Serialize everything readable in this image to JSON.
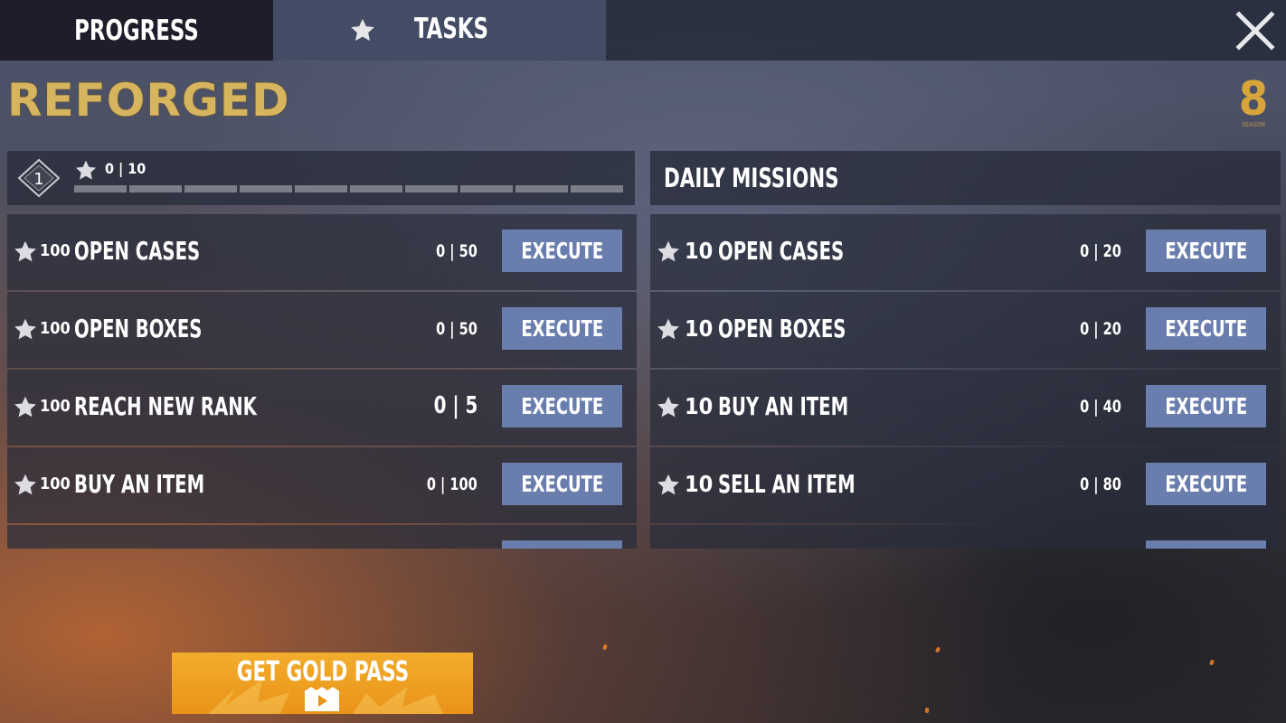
{
  "tabs": {
    "progress_label": "PROGRESS",
    "tasks_label": "TASKS"
  },
  "brand": {
    "logo_text": "REFORGED",
    "season_number": "8",
    "season_label": "SEASON"
  },
  "progress": {
    "level": "1",
    "stars": "0 | 10",
    "segments": 10,
    "filled_segments": 0
  },
  "daily": {
    "title": "DAILY MISSIONS"
  },
  "left_tasks": [
    {
      "reward": "100",
      "name": "OPEN CASES",
      "progress": "0 | 50",
      "action": "EXECUTE"
    },
    {
      "reward": "100",
      "name": "OPEN BOXES",
      "progress": "0 | 50",
      "action": "EXECUTE"
    },
    {
      "reward": "100",
      "name": "REACH NEW RANK",
      "progress": "0 | 5",
      "action": "EXECUTE"
    },
    {
      "reward": "100",
      "name": "BUY AN ITEM",
      "progress": "0 | 100",
      "action": "EXECUTE"
    }
  ],
  "right_tasks": [
    {
      "reward": "10",
      "name": "OPEN CASES",
      "progress": "0 | 20",
      "action": "EXECUTE"
    },
    {
      "reward": "10",
      "name": "OPEN BOXES",
      "progress": "0 | 20",
      "action": "EXECUTE"
    },
    {
      "reward": "10",
      "name": "BUY AN ITEM",
      "progress": "0 | 40",
      "action": "EXECUTE"
    },
    {
      "reward": "10",
      "name": "SELL AN ITEM",
      "progress": "0 | 80",
      "action": "EXECUTE"
    }
  ],
  "gold_pass": {
    "label": "GET GOLD PASS",
    "icon": "video-icon"
  },
  "colors": {
    "execute_button": "#6a7eae",
    "gold_button": "#f2ad2c",
    "logo": "#d7b45e"
  }
}
